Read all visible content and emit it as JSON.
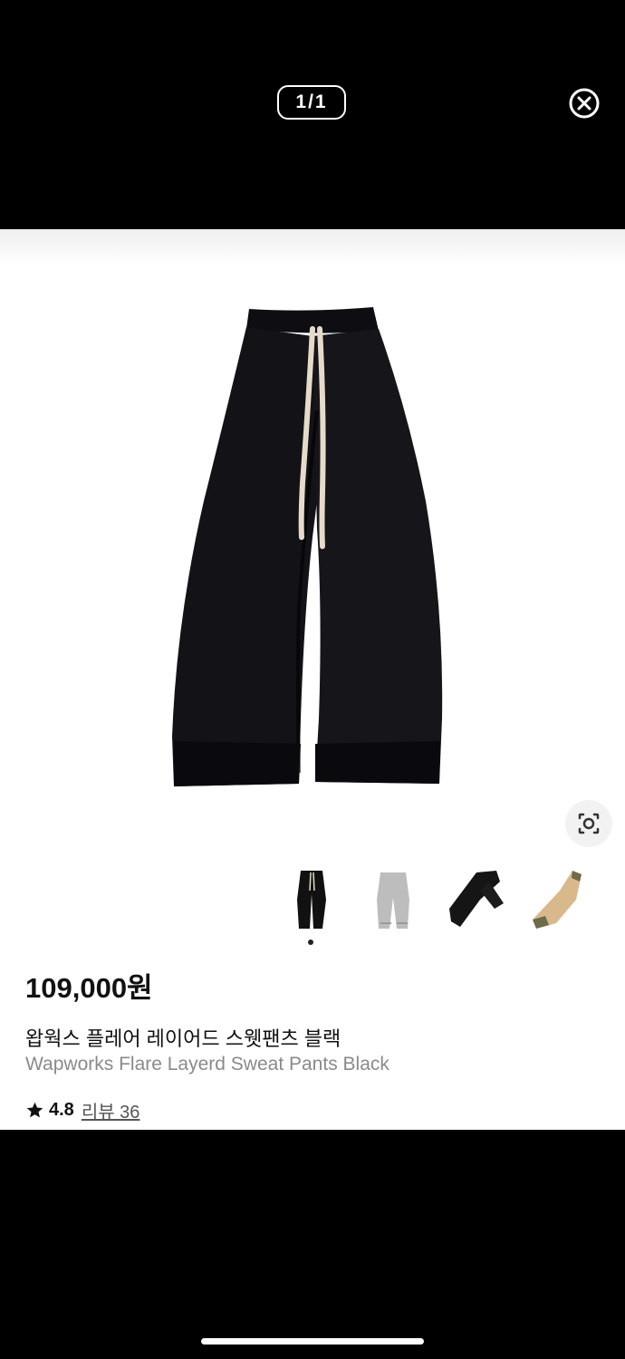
{
  "viewer": {
    "counter": "1/1",
    "close_icon": "close-circle-icon"
  },
  "product": {
    "price": "109,000원",
    "name_ko": "왑웍스 플레어 레이어드 스웻팬츠 블랙",
    "name_en": "Wapworks Flare Layerd Sweat Pants Black",
    "rating": "4.8",
    "review_label": "리뷰 36"
  },
  "thumbnails": [
    {
      "name": "black-pants-thumbnail",
      "color": "#111111",
      "selected": true
    },
    {
      "name": "gray-pants-thumbnail",
      "color": "#bdbdbd",
      "selected": false
    },
    {
      "name": "black-pants-angle-thumbnail",
      "color": "#151515",
      "selected": false
    },
    {
      "name": "beige-pants-thumbnail",
      "color": "#d9b98c",
      "selected": false
    }
  ],
  "colors": {
    "background": "#000000",
    "card": "#ffffff",
    "pants": "#121217",
    "drawstring": "#e8dccb"
  }
}
